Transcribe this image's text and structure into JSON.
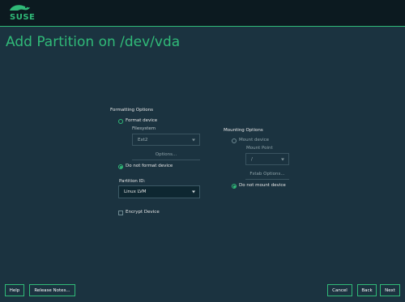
{
  "header": {
    "brand": "SUSE"
  },
  "page": {
    "title": "Add Partition on /dev/vda"
  },
  "formatting": {
    "group_title": "Formatting Options",
    "format_device_label": "Format device",
    "filesystem_label": "Filesystem",
    "filesystem_value": "Ext2",
    "options_button": "Options...",
    "do_not_format_label": "Do not format device",
    "partition_id_label": "Partition ID:",
    "partition_id_value": "Linux LVM",
    "encrypt_label": "Encrypt Device"
  },
  "mounting": {
    "group_title": "Mounting Options",
    "mount_device_label": "Mount device",
    "mount_point_label": "Mount Point",
    "mount_point_value": "/",
    "fstab_button": "Fstab Options...",
    "do_not_mount_label": "Do not mount device"
  },
  "footer": {
    "help": "Help",
    "release_notes": "Release Notes...",
    "cancel": "Cancel",
    "back": "Back",
    "next": "Next"
  },
  "colors": {
    "accent": "#30ba78",
    "background": "#1b3340",
    "topbar": "#0c1a20"
  }
}
